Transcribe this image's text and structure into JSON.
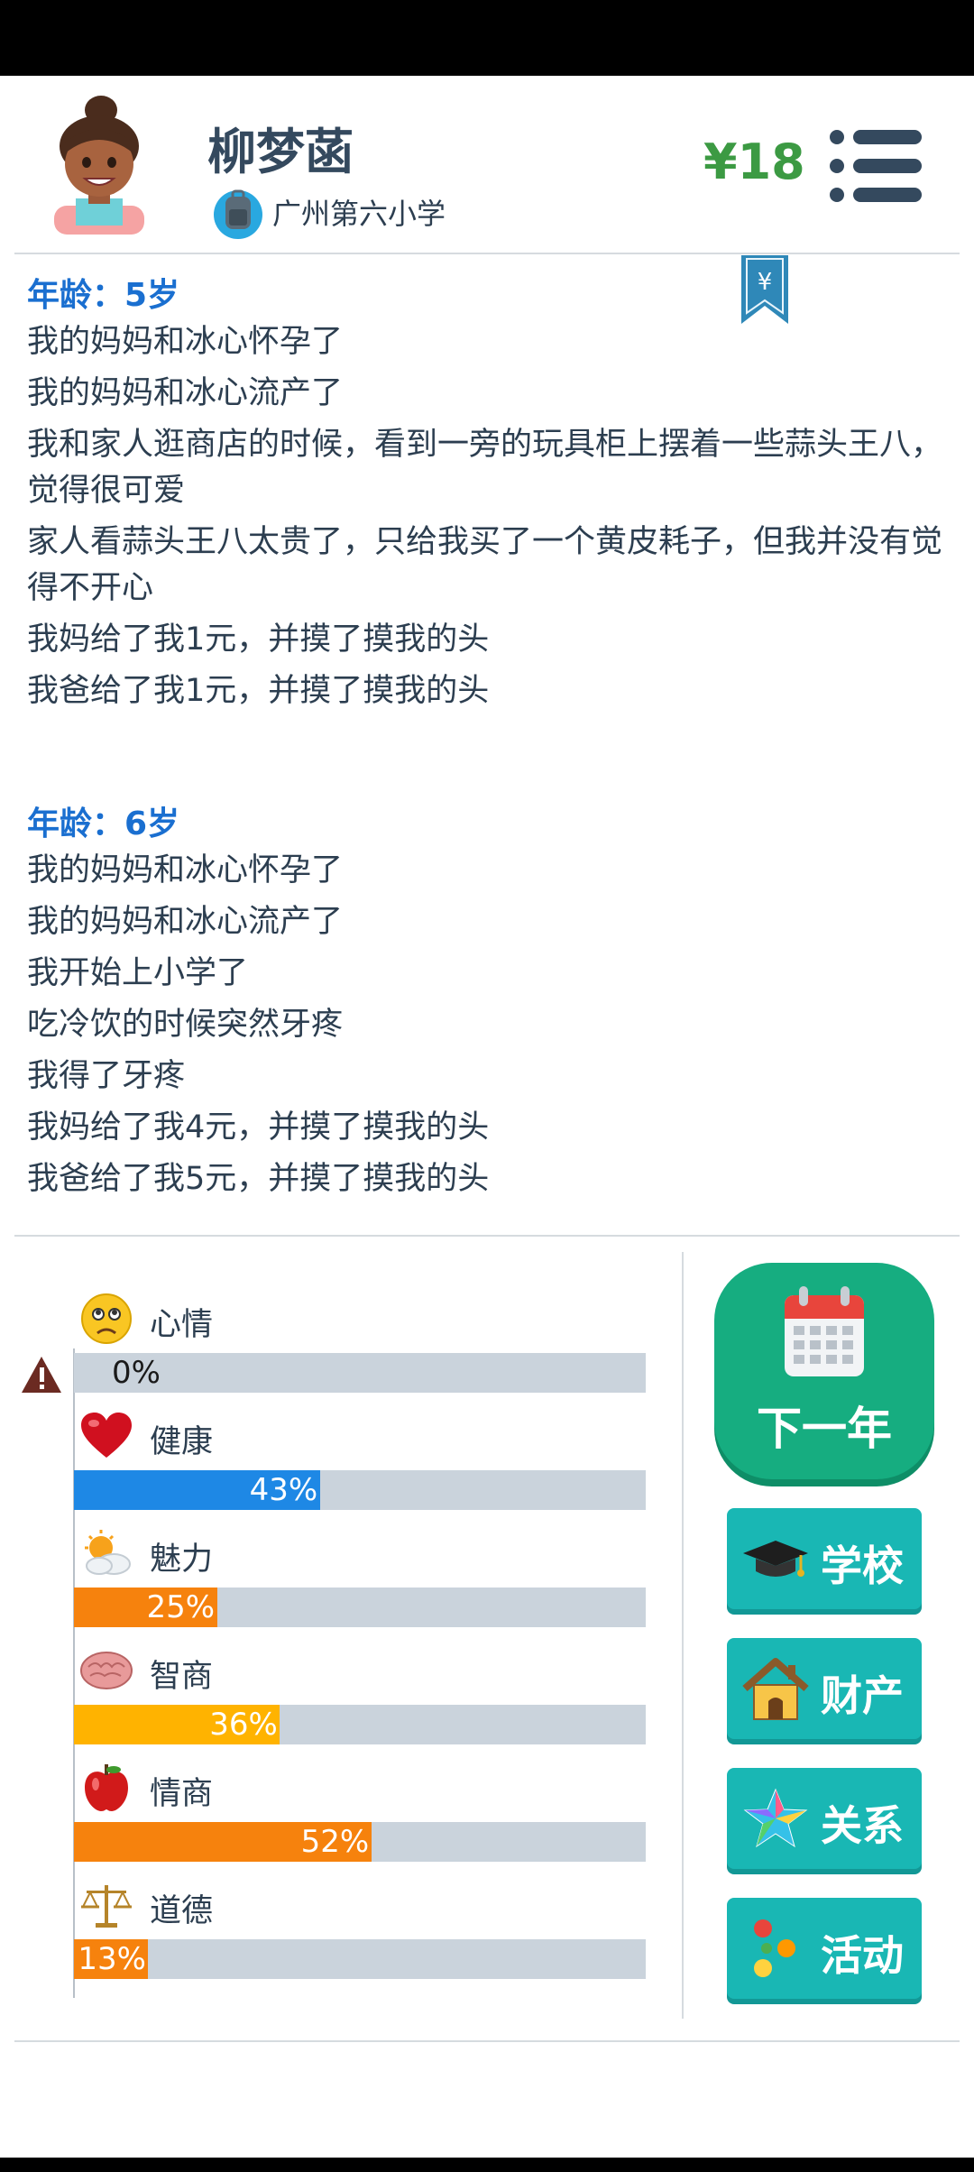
{
  "player": {
    "name": "柳梦菡",
    "school": "广州第六小学",
    "money": "¥18"
  },
  "bookmark_symbol": "¥",
  "log": [
    {
      "age": "年龄：5岁",
      "events": [
        "我的妈妈和冰心怀孕了",
        "我的妈妈和冰心流产了",
        "我和家人逛商店的时候，看到一旁的玩具柜上摆着一些蒜头王八，觉得很可爱",
        "家人看蒜头王八太贵了，只给我买了一个黄皮耗子，但我并没有觉得不开心",
        "我妈给了我1元，并摸了摸我的头",
        "我爸给了我1元，并摸了摸我的头"
      ]
    },
    {
      "age": "年龄：6岁",
      "events": [
        "我的妈妈和冰心怀孕了",
        "我的妈妈和冰心流产了",
        "我开始上小学了",
        "吃冷饮的时候突然牙疼",
        "我得了牙疼",
        "我妈给了我4元，并摸了摸我的头",
        "我爸给了我5元，并摸了摸我的头"
      ]
    }
  ],
  "stats": [
    {
      "label": "心情",
      "percent": 0,
      "text": "0%",
      "color": "#c8d2dc",
      "icon": "sad-face-icon"
    },
    {
      "label": "健康",
      "percent": 43,
      "text": "43%",
      "color": "#1e88e5",
      "icon": "heart-icon"
    },
    {
      "label": "魅力",
      "percent": 25,
      "text": "25%",
      "color": "#f6820d",
      "icon": "sun-cloud-icon"
    },
    {
      "label": "智商",
      "percent": 36,
      "text": "36%",
      "color": "#ffb300",
      "icon": "brain-icon"
    },
    {
      "label": "情商",
      "percent": 52,
      "text": "52%",
      "color": "#f6820d",
      "icon": "apple-icon"
    },
    {
      "label": "道德",
      "percent": 13,
      "text": "13%",
      "color": "#f6820d",
      "icon": "scales-icon"
    }
  ],
  "buttons": {
    "next_year": "下一年",
    "school": "学校",
    "property": "财产",
    "relations": "关系",
    "activities": "活动"
  },
  "colors": {
    "accent_green": "#16ad80",
    "button_teal": "#19b7b4",
    "money_green": "#3c9a43",
    "age_blue": "#1a6fd0"
  }
}
